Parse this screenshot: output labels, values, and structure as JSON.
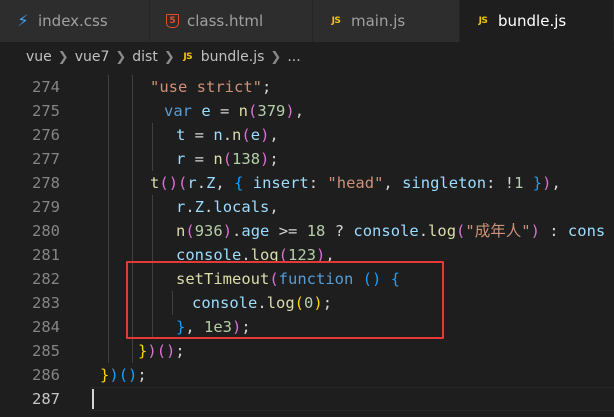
{
  "tabs": [
    {
      "label": "index.css",
      "icon": "css-icon",
      "icon_text": "⚡",
      "active": false
    },
    {
      "label": "class.html",
      "icon": "html-icon",
      "icon_text": "5",
      "active": false
    },
    {
      "label": "main.js",
      "icon": "js-icon",
      "icon_text": "JS",
      "active": false
    },
    {
      "label": "bundle.js",
      "icon": "js-icon",
      "icon_text": "JS",
      "active": true
    }
  ],
  "breadcrumb": {
    "parts": [
      "vue",
      "vue7",
      "dist"
    ],
    "file_icon_text": "JS",
    "file": "bundle.js",
    "trailing": "..."
  },
  "editor": {
    "lines": [
      {
        "num": "274",
        "code": [
          [
            "t-str",
            "\"use strict\""
          ],
          [
            "t-pun",
            ";"
          ]
        ]
      },
      {
        "num": "275",
        "code": [
          [
            "t-kw",
            "var "
          ],
          [
            "t-var",
            "e"
          ],
          [
            "t-pun",
            " = "
          ],
          [
            "t-fn",
            "n"
          ],
          [
            "t-b1",
            "("
          ],
          [
            "t-num",
            "379"
          ],
          [
            "t-b1",
            ")"
          ],
          [
            "t-pun",
            ","
          ]
        ]
      },
      {
        "num": "276",
        "code": [
          [
            "t-var",
            "t"
          ],
          [
            "t-pun",
            " = "
          ],
          [
            "t-var",
            "n"
          ],
          [
            "t-pun",
            "."
          ],
          [
            "t-fn",
            "n"
          ],
          [
            "t-b1",
            "("
          ],
          [
            "t-var",
            "e"
          ],
          [
            "t-b1",
            ")"
          ],
          [
            "t-pun",
            ","
          ]
        ]
      },
      {
        "num": "277",
        "code": [
          [
            "t-var",
            "r"
          ],
          [
            "t-pun",
            " = "
          ],
          [
            "t-fn",
            "n"
          ],
          [
            "t-b1",
            "("
          ],
          [
            "t-num",
            "138"
          ],
          [
            "t-b1",
            ")"
          ],
          [
            "t-pun",
            ";"
          ]
        ]
      },
      {
        "num": "278",
        "code": [
          [
            "t-fn",
            "t"
          ],
          [
            "t-b1",
            "("
          ],
          [
            "t-b1",
            ")"
          ],
          [
            "t-b1",
            "("
          ],
          [
            "t-var",
            "r"
          ],
          [
            "t-pun",
            "."
          ],
          [
            "t-var",
            "Z"
          ],
          [
            "t-pun",
            ", "
          ],
          [
            "t-b2",
            "{ "
          ],
          [
            "t-var",
            "insert"
          ],
          [
            "t-pun",
            ": "
          ],
          [
            "t-str",
            "\"head\""
          ],
          [
            "t-pun",
            ", "
          ],
          [
            "t-var",
            "singleton"
          ],
          [
            "t-pun",
            ": !"
          ],
          [
            "t-num",
            "1"
          ],
          [
            "t-b2",
            " }"
          ],
          [
            "t-b1",
            ")"
          ],
          [
            "t-pun",
            ","
          ]
        ]
      },
      {
        "num": "279",
        "code": [
          [
            "t-var",
            "r"
          ],
          [
            "t-pun",
            "."
          ],
          [
            "t-var",
            "Z"
          ],
          [
            "t-pun",
            "."
          ],
          [
            "t-var",
            "locals"
          ],
          [
            "t-pun",
            ","
          ]
        ]
      },
      {
        "num": "280",
        "code": [
          [
            "t-fn",
            "n"
          ],
          [
            "t-b1",
            "("
          ],
          [
            "t-num",
            "936"
          ],
          [
            "t-b1",
            ")"
          ],
          [
            "t-pun",
            "."
          ],
          [
            "t-var",
            "age"
          ],
          [
            "t-pun",
            " >= "
          ],
          [
            "t-num",
            "18"
          ],
          [
            "t-pun",
            " ? "
          ],
          [
            "t-var",
            "console"
          ],
          [
            "t-pun",
            "."
          ],
          [
            "t-fn",
            "log"
          ],
          [
            "t-b1",
            "("
          ],
          [
            "t-str",
            "\"成年人\""
          ],
          [
            "t-b1",
            ")"
          ],
          [
            "t-pun",
            " : "
          ],
          [
            "t-var",
            "cons"
          ]
        ]
      },
      {
        "num": "281",
        "code": [
          [
            "t-var",
            "console"
          ],
          [
            "t-pun",
            "."
          ],
          [
            "t-fn",
            "log"
          ],
          [
            "t-b1",
            "("
          ],
          [
            "t-num",
            "123"
          ],
          [
            "t-b1",
            ")"
          ],
          [
            "t-pun",
            ","
          ]
        ]
      },
      {
        "num": "282",
        "code": [
          [
            "t-fn",
            "setTimeout"
          ],
          [
            "t-b1",
            "("
          ],
          [
            "t-kw",
            "function"
          ],
          [
            "t-pun",
            " "
          ],
          [
            "t-b2",
            "()"
          ],
          [
            "t-pun",
            " "
          ],
          [
            "t-b2",
            "{"
          ]
        ]
      },
      {
        "num": "283",
        "code": [
          [
            "t-var",
            "console"
          ],
          [
            "t-pun",
            "."
          ],
          [
            "t-fn",
            "log"
          ],
          [
            "t-b3",
            "("
          ],
          [
            "t-num",
            "0"
          ],
          [
            "t-b3",
            ")"
          ],
          [
            "t-pun",
            ";"
          ]
        ]
      },
      {
        "num": "284",
        "code": [
          [
            "t-b2",
            "}"
          ],
          [
            "t-pun",
            ", "
          ],
          [
            "t-num",
            "1e3"
          ],
          [
            "t-b1",
            ")"
          ],
          [
            "t-pun",
            ";"
          ]
        ]
      },
      {
        "num": "285",
        "code": [
          [
            "t-b3",
            "}"
          ],
          [
            "t-b1",
            ")"
          ],
          [
            "t-b1",
            "("
          ],
          [
            "t-b1",
            ")"
          ],
          [
            "t-pun",
            ";"
          ]
        ]
      },
      {
        "num": "286",
        "code": [
          [
            "t-b3",
            "}"
          ],
          [
            "t-b2",
            ")"
          ],
          [
            "t-b2",
            "("
          ],
          [
            "t-b2",
            ")"
          ],
          [
            "t-pun",
            ";"
          ]
        ]
      },
      {
        "num": "287",
        "code": []
      }
    ]
  }
}
